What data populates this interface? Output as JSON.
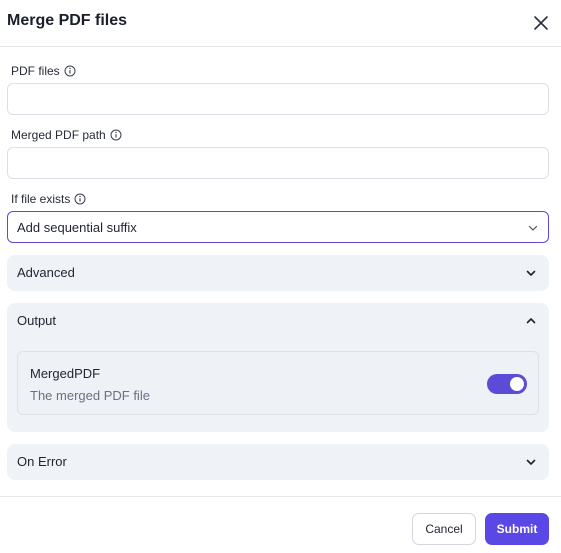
{
  "dialog": {
    "title": "Merge PDF files"
  },
  "fields": {
    "pdf_files": {
      "label": "PDF files",
      "value": "",
      "placeholder": ""
    },
    "merged_path": {
      "label": "Merged PDF path",
      "value": "",
      "placeholder": ""
    },
    "if_exists": {
      "label": "If file exists",
      "selected": "Add sequential suffix"
    }
  },
  "sections": {
    "advanced": {
      "title": "Advanced",
      "expanded": false
    },
    "output": {
      "title": "Output",
      "expanded": true,
      "item": {
        "name": "MergedPDF",
        "description": "The merged PDF file",
        "enabled": true
      }
    },
    "on_error": {
      "title": "On Error",
      "expanded": false
    }
  },
  "footer": {
    "cancel_label": "Cancel",
    "submit_label": "Submit"
  },
  "colors": {
    "accent": "#5a48e6",
    "section_bg": "#eff2f7",
    "border": "#dcdfe6"
  },
  "icons": {
    "close": "close-icon",
    "info": "info-icon",
    "chevron_down": "chevron-down-icon",
    "chevron_up": "chevron-up-icon"
  }
}
